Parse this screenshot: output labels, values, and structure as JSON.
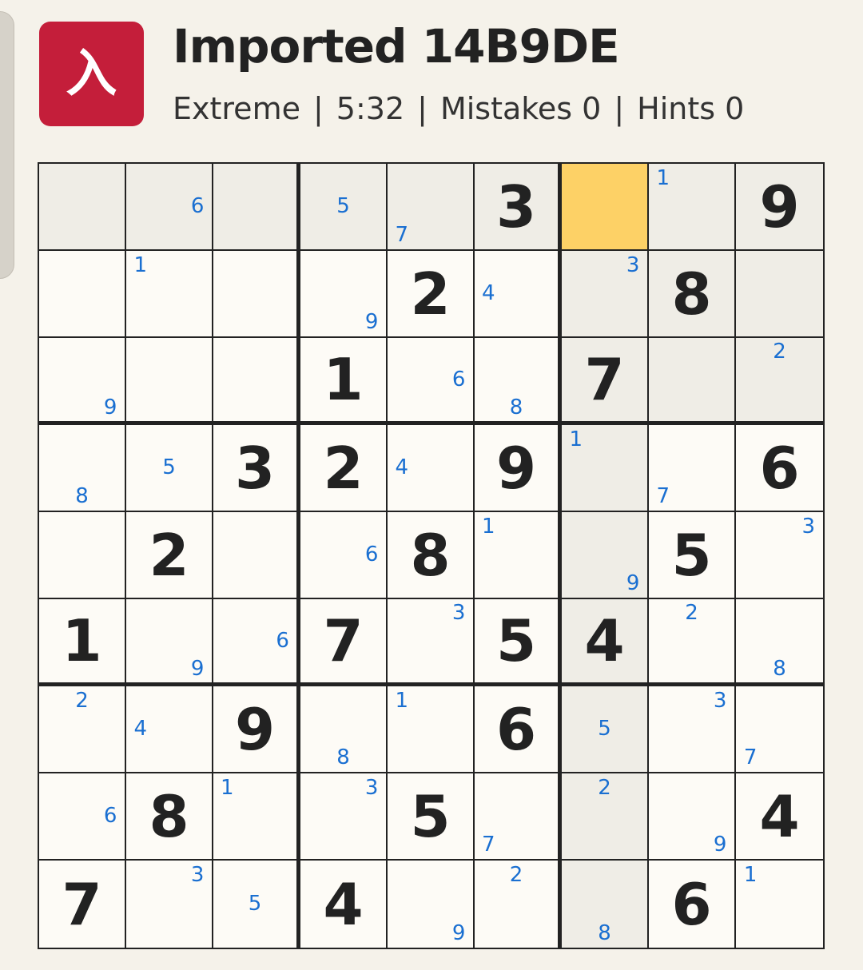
{
  "app_icon_glyph": "入",
  "title": "Imported 14B9DE",
  "status": {
    "difficulty": "Extreme",
    "time": "5:32",
    "mistakes": "Mistakes 0",
    "hints": "Hints 0",
    "separator": "|"
  },
  "selected": [
    0,
    6
  ],
  "grid": [
    [
      0,
      0,
      0,
      0,
      0,
      3,
      0,
      0,
      9
    ],
    [
      0,
      0,
      0,
      0,
      2,
      0,
      0,
      8,
      0
    ],
    [
      0,
      0,
      0,
      1,
      0,
      0,
      7,
      0,
      0
    ],
    [
      0,
      0,
      3,
      2,
      0,
      9,
      0,
      0,
      6
    ],
    [
      0,
      2,
      0,
      0,
      8,
      0,
      0,
      5,
      0
    ],
    [
      1,
      0,
      0,
      7,
      0,
      5,
      4,
      0,
      0
    ],
    [
      0,
      0,
      9,
      0,
      0,
      6,
      0,
      0,
      0
    ],
    [
      0,
      8,
      0,
      0,
      5,
      0,
      0,
      0,
      4
    ],
    [
      7,
      0,
      0,
      4,
      0,
      0,
      0,
      6,
      0
    ]
  ],
  "notes": {
    "0,1": [
      6
    ],
    "0,3": [
      5
    ],
    "0,4": [
      7
    ],
    "0,7": [
      1
    ],
    "1,1": [
      1
    ],
    "1,3": [
      9
    ],
    "1,5": [
      4
    ],
    "1,6": [
      3
    ],
    "2,0": [
      9
    ],
    "2,4": [
      6
    ],
    "2,5": [
      8
    ],
    "2,8": [
      2
    ],
    "3,0": [
      8
    ],
    "3,1": [
      5
    ],
    "3,4": [
      4
    ],
    "3,6": [
      1
    ],
    "3,7": [
      7
    ],
    "4,3": [
      6
    ],
    "4,5": [
      1
    ],
    "4,6": [
      9
    ],
    "4,8": [
      3
    ],
    "5,1": [
      9
    ],
    "5,2": [
      6
    ],
    "5,4": [
      3
    ],
    "5,7": [
      2
    ],
    "5,8": [
      8
    ],
    "6,0": [
      2
    ],
    "6,1": [
      4
    ],
    "6,3": [
      8
    ],
    "6,4": [
      1
    ],
    "6,6": [
      5
    ],
    "6,7": [
      3
    ],
    "6,8": [
      7
    ],
    "7,0": [
      6
    ],
    "7,2": [
      1
    ],
    "7,3": [
      3
    ],
    "7,5": [
      7
    ],
    "7,6": [
      2
    ],
    "7,7": [
      9
    ],
    "8,1": [
      3
    ],
    "8,2": [
      5
    ],
    "8,4": [
      9
    ],
    "8,5": [
      2
    ],
    "8,6": [
      8
    ],
    "8,8": [
      1
    ]
  }
}
